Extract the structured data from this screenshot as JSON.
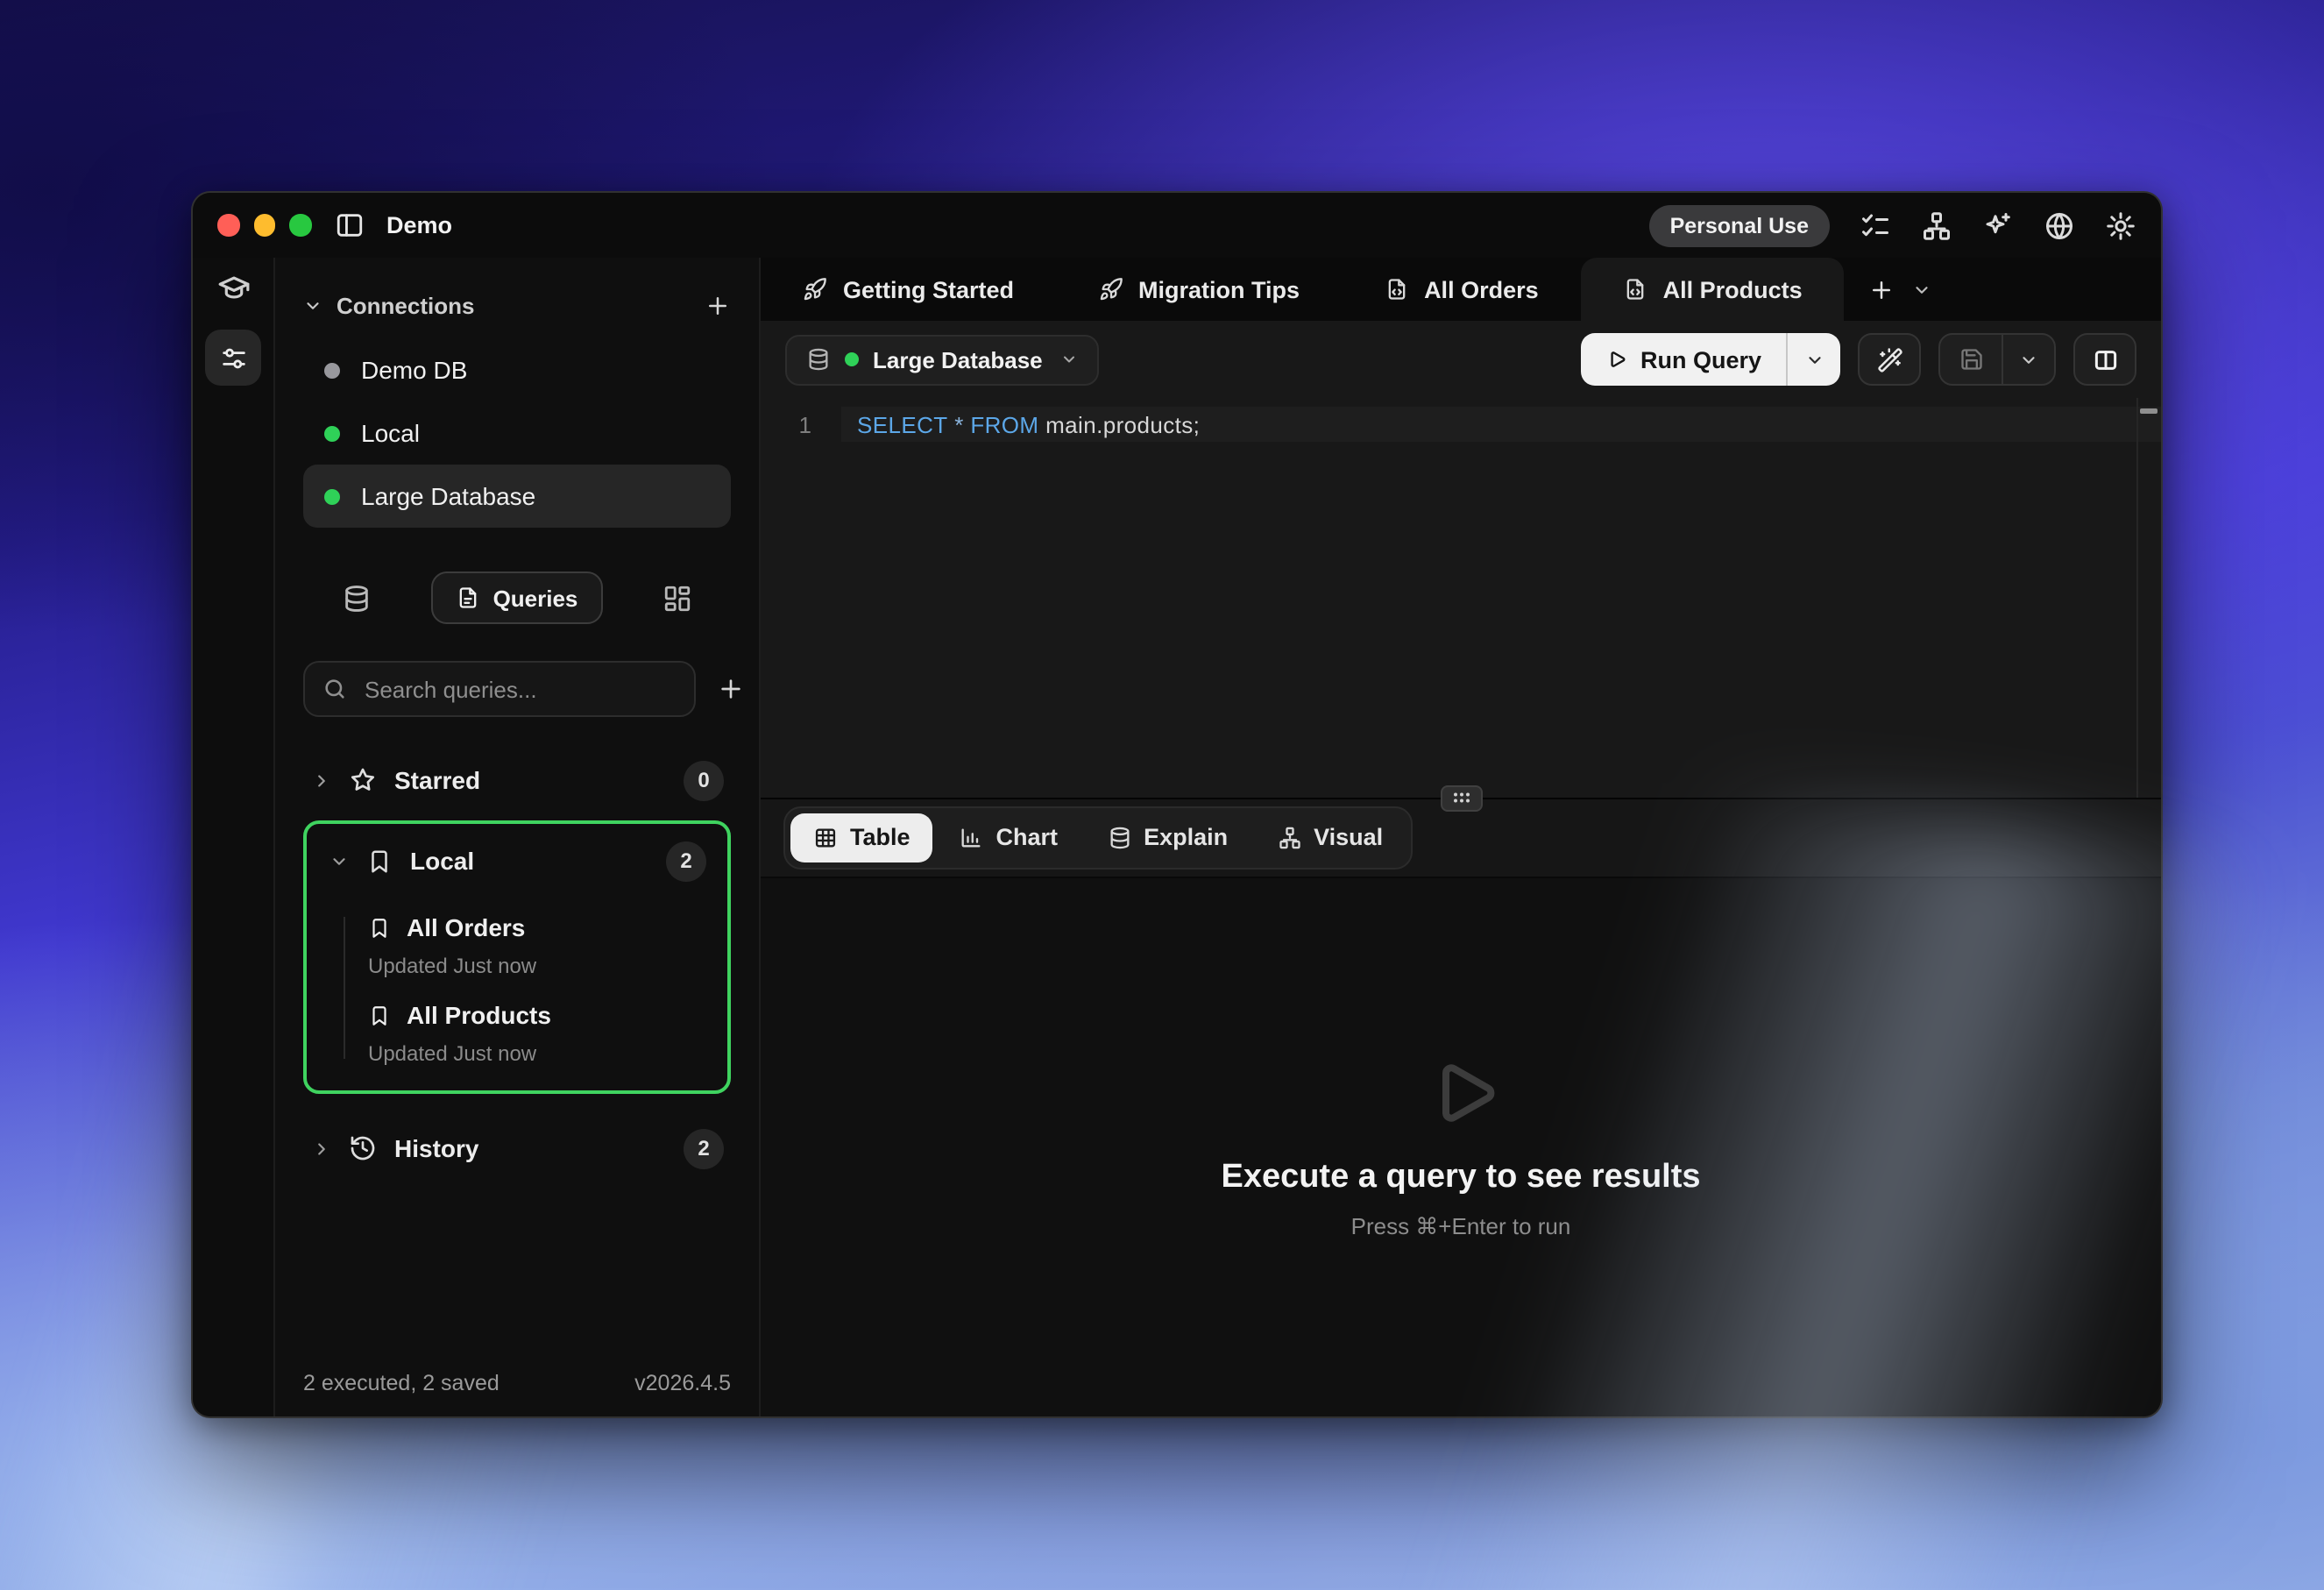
{
  "window": {
    "title": "Demo"
  },
  "titlebar": {
    "license_badge": "Personal Use"
  },
  "sidebar": {
    "connections": {
      "header": "Connections",
      "items": [
        {
          "name": "Demo DB",
          "status": "gray"
        },
        {
          "name": "Local",
          "status": "green"
        },
        {
          "name": "Large Database",
          "status": "green",
          "selected": true
        }
      ]
    },
    "nav": {
      "queries_label": "Queries"
    },
    "search": {
      "placeholder": "Search queries..."
    },
    "groups": {
      "starred": {
        "label": "Starred",
        "count": "0"
      },
      "local": {
        "label": "Local",
        "count": "2",
        "items": [
          {
            "name": "All Orders",
            "updated": "Updated Just now"
          },
          {
            "name": "All Products",
            "updated": "Updated Just now"
          }
        ]
      },
      "history": {
        "label": "History",
        "count": "2"
      }
    },
    "status": {
      "summary": "2 executed, 2 saved",
      "version": "v2026.4.5"
    }
  },
  "tabs": [
    {
      "label": "Getting Started",
      "icon": "rocket"
    },
    {
      "label": "Migration Tips",
      "icon": "rocket"
    },
    {
      "label": "All Orders",
      "icon": "file-code"
    },
    {
      "label": "All Products",
      "icon": "file-code",
      "active": true
    }
  ],
  "toolbar": {
    "database_label": "Large Database",
    "run_label": "Run Query"
  },
  "editor": {
    "line_number": "1",
    "sql": {
      "kw1": "SELECT",
      "star": "*",
      "kw2": "FROM",
      "rest": "main.products;"
    }
  },
  "results": {
    "tabs": [
      "Table",
      "Chart",
      "Explain",
      "Visual"
    ],
    "active_tab": "Table",
    "empty_title": "Execute a query to see results",
    "empty_hint": "Press ⌘+Enter to run"
  },
  "colors": {
    "accent_green": "#2fd158",
    "selection_border": "#3fd35f",
    "sql_keyword": "#5ca7e8",
    "run_button_bg": "#f1f1f1",
    "traffic_red": "#ff5f57",
    "traffic_yellow": "#febc2e",
    "traffic_green": "#28c840"
  },
  "icons": {
    "sidebar-toggle-icon": "◫",
    "checklist-icon": "☑",
    "hierarchy-icon": "⎇",
    "sparkles-icon": "✦",
    "globe-icon": "⊕",
    "gear-icon": "⚙",
    "graduation-cap-icon": "🎓",
    "sliders-icon": "⚟",
    "chevron-down-icon": "⌄",
    "chevron-right-icon": "›",
    "plus-icon": "+",
    "database-icon": "⛁",
    "document-icon": "🗎",
    "layout-grid-icon": "▦",
    "search-icon": "⌕",
    "star-icon": "☆",
    "bookmark-icon": "⧉",
    "history-icon": "↺",
    "rocket-icon": "🚀",
    "file-code-icon": "</>",
    "play-icon": "▷",
    "magic-wand-icon": "✦",
    "save-icon": "💾",
    "columns-icon": "◫",
    "table-icon": "▦",
    "bar-chart-icon": "▥",
    "grip-icon": "⋮⋮",
    "command-glyph": "⌘"
  }
}
